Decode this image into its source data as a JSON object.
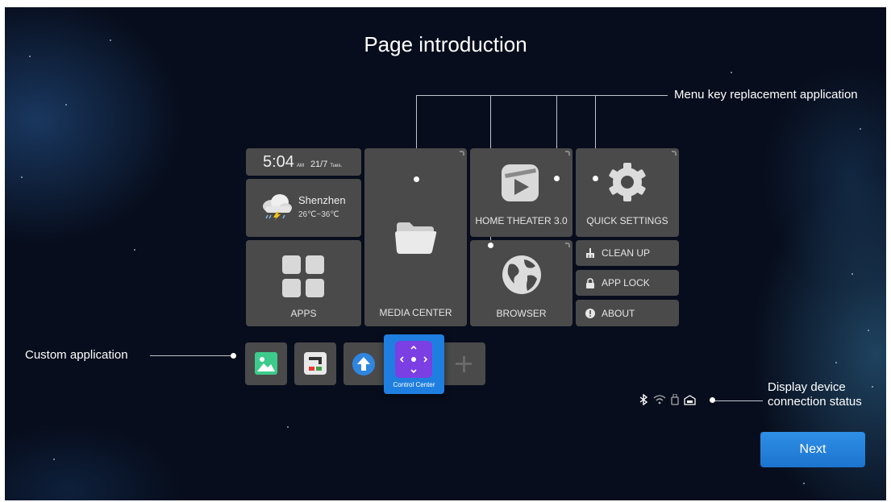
{
  "header": {
    "title": "Page introduction"
  },
  "annotations": {
    "menu_key": "Menu key replacement application",
    "custom_app": "Custom application",
    "device_status": "Display device connection status"
  },
  "clock": {
    "time": "5:04",
    "ampm": "AM",
    "date": "21/7",
    "weekday": "Tues."
  },
  "weather": {
    "city": "Shenzhen",
    "range": "26℃~36℃"
  },
  "tiles": {
    "apps": "APPS",
    "media_center": "MEDIA CENTER",
    "home_theater": "HOME THEATER 3.0",
    "quick_settings": "QUICK SETTINGS",
    "browser": "BROWSER",
    "clean_up": "CLEAN UP",
    "app_lock": "APP LOCK",
    "about": "ABOUT"
  },
  "dock": {
    "focused_label": "Control Center"
  },
  "status_icons": [
    "bluetooth-icon",
    "wifi-icon",
    "usb-icon",
    "ethernet-icon"
  ],
  "buttons": {
    "next": "Next"
  },
  "colors": {
    "accent": "#1f7fe0",
    "control_center": "#7b3fe4",
    "tile": "#4a4a4a",
    "background": "#070d1c"
  }
}
